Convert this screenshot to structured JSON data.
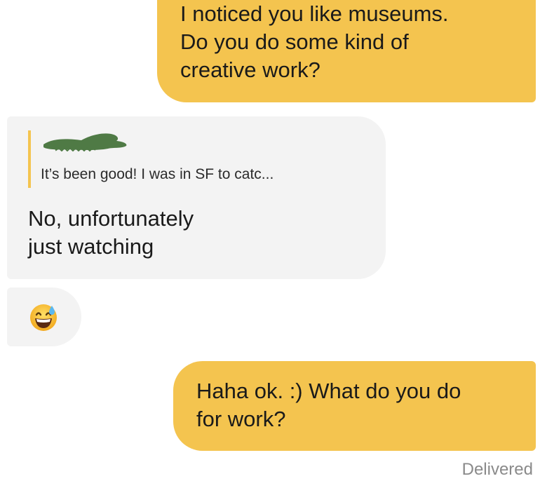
{
  "messages": [
    {
      "direction": "outgoing",
      "text": "I noticed you like museums.\nDo you do some kind of\ncreative work?"
    },
    {
      "direction": "incoming",
      "reply_preview": {
        "author_redacted": true,
        "text": "It’s been good! I was in SF to catc..."
      },
      "text": "No, unfortunately\njust watching"
    },
    {
      "direction": "incoming",
      "emoji": "grinning-face-with-sweat-icon"
    },
    {
      "direction": "outgoing",
      "text": "Haha ok. :) What do you do\nfor work?"
    }
  ],
  "status": "Delivered",
  "colors": {
    "outgoing_bubble": "#f4c44f",
    "incoming_bubble": "#f3f3f3",
    "quote_bar": "#f4c44f",
    "redaction": "#4f7a45",
    "status_text": "#8a8a8a"
  }
}
